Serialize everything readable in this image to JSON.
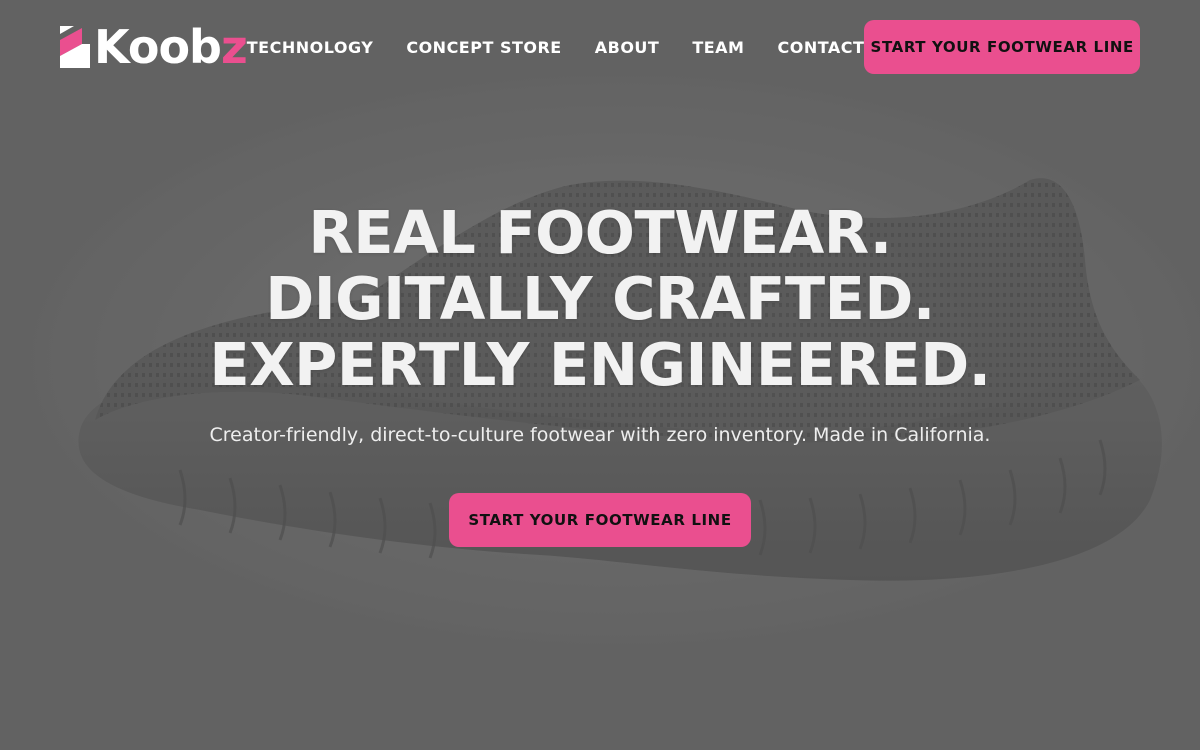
{
  "brand": {
    "name_main": "Koob",
    "name_accent": "z",
    "accent_color": "#ea4f8f"
  },
  "nav": {
    "links": [
      "TECHNOLOGY",
      "CONCEPT STORE",
      "ABOUT",
      "TEAM",
      "CONTACT"
    ],
    "cta_label": "START YOUR FOOTWEAR LINE"
  },
  "hero": {
    "headline": [
      "REAL FOOTWEAR.",
      "DIGITALLY CRAFTED.",
      "EXPERTLY ENGINEERED."
    ],
    "subtitle": "Creator-friendly, direct-to-culture footwear with zero inventory. Made in California.",
    "cta_label": "START YOUR FOOTWEAR LINE",
    "background_image": "knit-sneaker-photo"
  }
}
